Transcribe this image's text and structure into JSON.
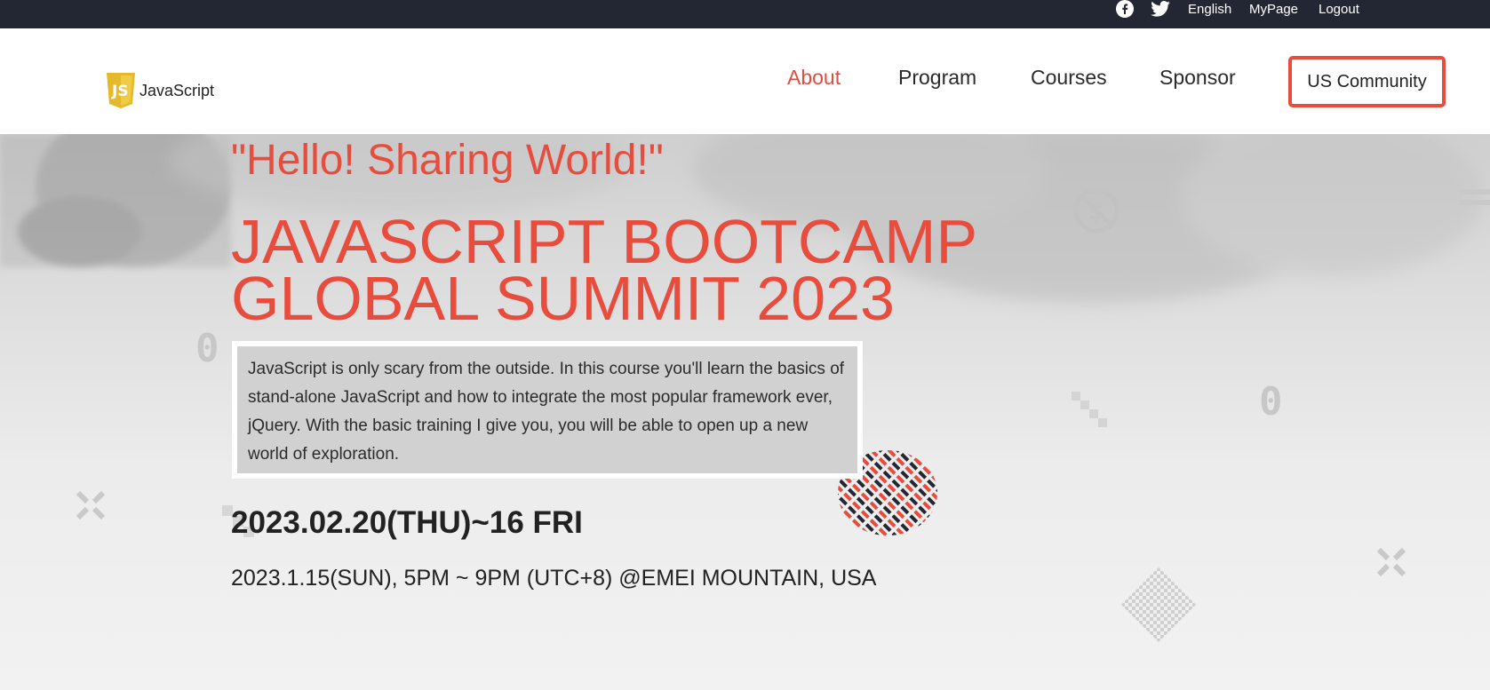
{
  "topbar": {
    "icons": [
      "facebook-icon",
      "twitter-icon"
    ],
    "language": "English",
    "mypage": "MyPage",
    "logout": "Logout"
  },
  "header": {
    "logo_text": "JavaScript",
    "nav": [
      "About",
      "Program",
      "Courses",
      "Sponsor"
    ],
    "community_button": "US Community"
  },
  "hero": {
    "tagline": "\"Hello! Sharing World!\"",
    "title_line1": "JAVASCRIPT BOOTCAMP",
    "title_line2": "GLOBAL SUMMIT 2023",
    "description": "JavaScript is only scary from the outside. In this course you'll learn the basics of stand-alone JavaScript and how to integrate the most popular framework ever, jQuery. With the basic training I give you, you will be able to open up a new world of exploration.",
    "dates": "2023.02.20(THU)~16 FRI",
    "venue": "2023.1.15(SUN), 5PM ~ 9PM (UTC+8) @EMEI MOUNTAIN, USA"
  },
  "colors": {
    "accent": "#e84c3d",
    "topbar_bg": "#232733",
    "logo_yellow": "#e5b92a"
  }
}
